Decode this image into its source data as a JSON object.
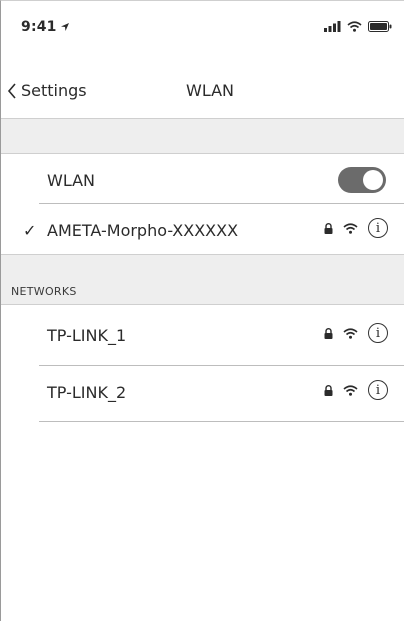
{
  "status_bar": {
    "time": "9:41",
    "icons": [
      "location-arrow-icon",
      "signal-bars-icon",
      "wifi-icon",
      "battery-icon"
    ]
  },
  "nav": {
    "back_label": "Settings",
    "title": "WLAN"
  },
  "wlan_toggle": {
    "label": "WLAN",
    "on": true
  },
  "current_network": {
    "checkmark": "✓",
    "name": "AMETA-Morpho-XXXXXX",
    "secured": true
  },
  "networks_section": {
    "header": "NETWORKS",
    "items": [
      {
        "name": "TP-LINK_1",
        "secured": true
      },
      {
        "name": "TP-LINK_2",
        "secured": true
      }
    ]
  },
  "info_glyph": "i",
  "colors": {
    "band_gray": "#eeeeee",
    "toggle_on": "#6b6b6b"
  }
}
